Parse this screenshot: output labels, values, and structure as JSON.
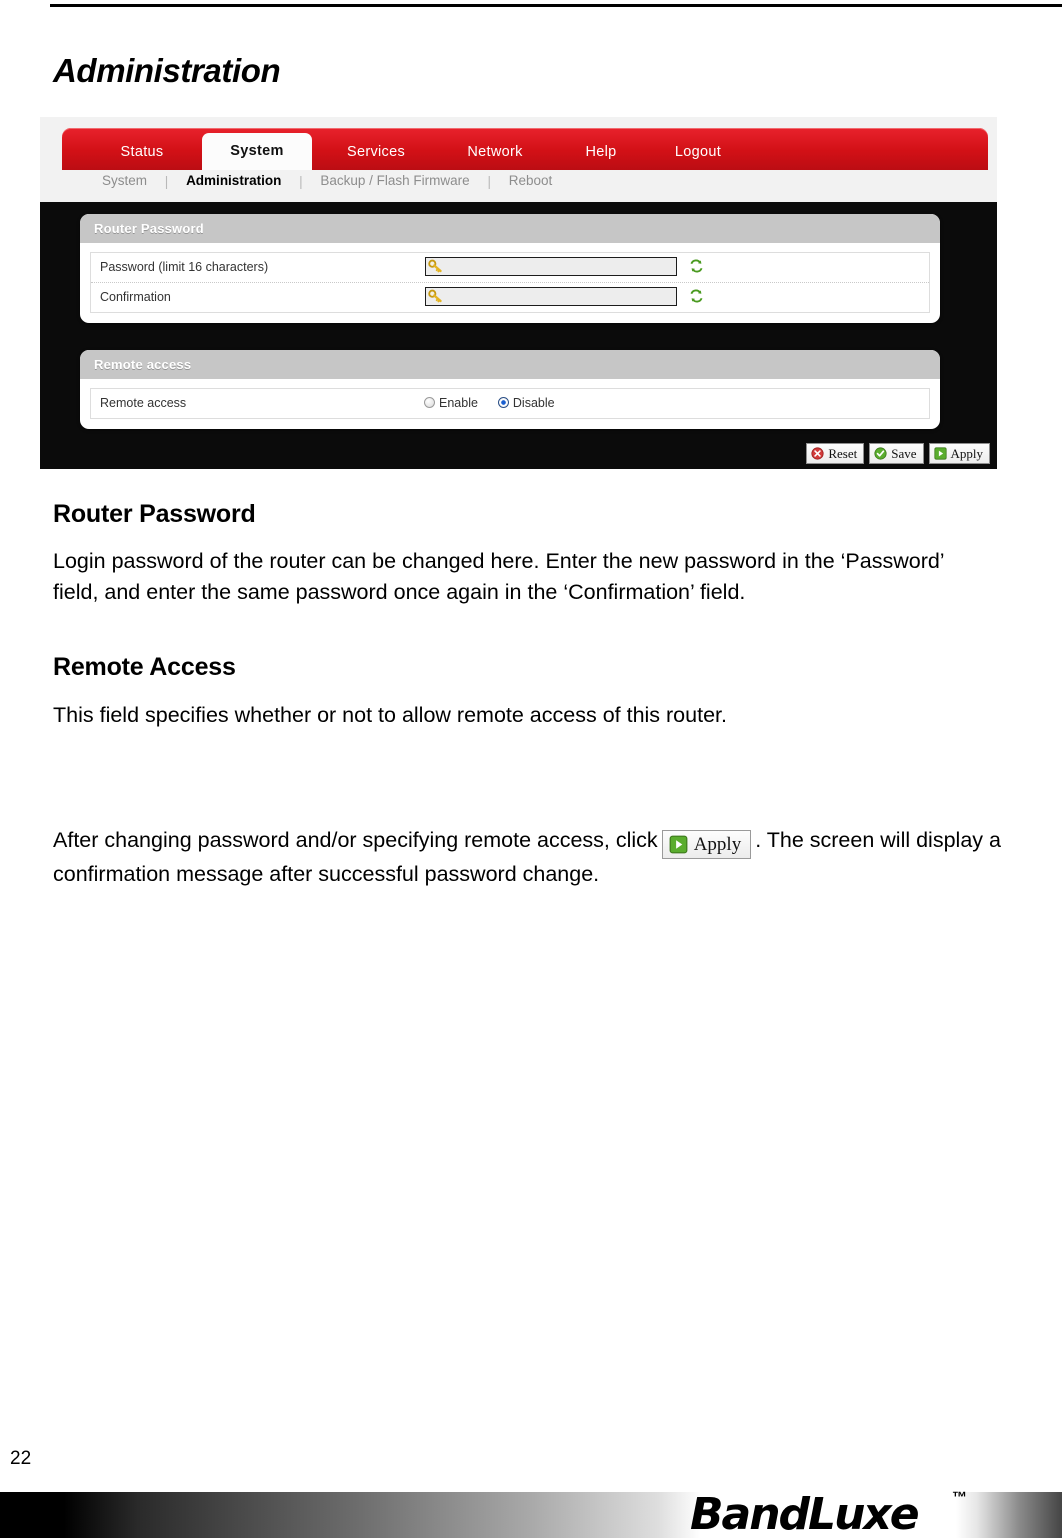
{
  "page": {
    "title": "Administration",
    "number": "22"
  },
  "screenshot": {
    "tabs": [
      {
        "label": "Status",
        "active": false
      },
      {
        "label": "System",
        "active": true
      },
      {
        "label": "Services",
        "active": false
      },
      {
        "label": "Network",
        "active": false
      },
      {
        "label": "Help",
        "active": false
      },
      {
        "label": "Logout",
        "active": false
      }
    ],
    "subnav": [
      {
        "label": "System",
        "active": false
      },
      {
        "label": "Administration",
        "active": true
      },
      {
        "label": "Backup / Flash Firmware",
        "active": false
      },
      {
        "label": "Reboot",
        "active": false
      }
    ],
    "panels": [
      {
        "heading": "Router Password",
        "rows": [
          {
            "label": "Password (limit 16 characters)",
            "value": "",
            "type": "password"
          },
          {
            "label": "Confirmation",
            "value": "",
            "type": "password"
          }
        ]
      },
      {
        "heading": "Remote access",
        "rows": [
          {
            "label": "Remote access",
            "type": "radio",
            "options": [
              {
                "label": "Enable",
                "selected": false
              },
              {
                "label": "Disable",
                "selected": true
              }
            ]
          }
        ]
      }
    ],
    "buttons": [
      {
        "label": "Reset",
        "icon": "reset-x-icon"
      },
      {
        "label": "Save",
        "icon": "save-check-icon"
      },
      {
        "label": "Apply",
        "icon": "apply-play-icon"
      }
    ],
    "colors": {
      "tabbar_red": "#d21016",
      "panel_head_gray": "#c6c6c6",
      "panel_bg_dark": "#0b0b0b",
      "radio_selected_blue": "#1a5fd0"
    }
  },
  "sections": [
    {
      "heading": "Router Password",
      "body": "Login password of the router can be changed here. Enter the new password in the ‘Password’ field, and enter the same password once again in the ‘Confirmation’ field."
    },
    {
      "heading": "Remote Access",
      "body": "This field specifies whether or not to allow remote access of this router."
    }
  ],
  "closing": {
    "before": "After changing password and/or specifying remote access, click",
    "button_label": "Apply",
    "after": ". The screen will display a confirmation message after successful password change."
  },
  "footer": {
    "brand": "BandLuxe",
    "trademark": "™"
  }
}
